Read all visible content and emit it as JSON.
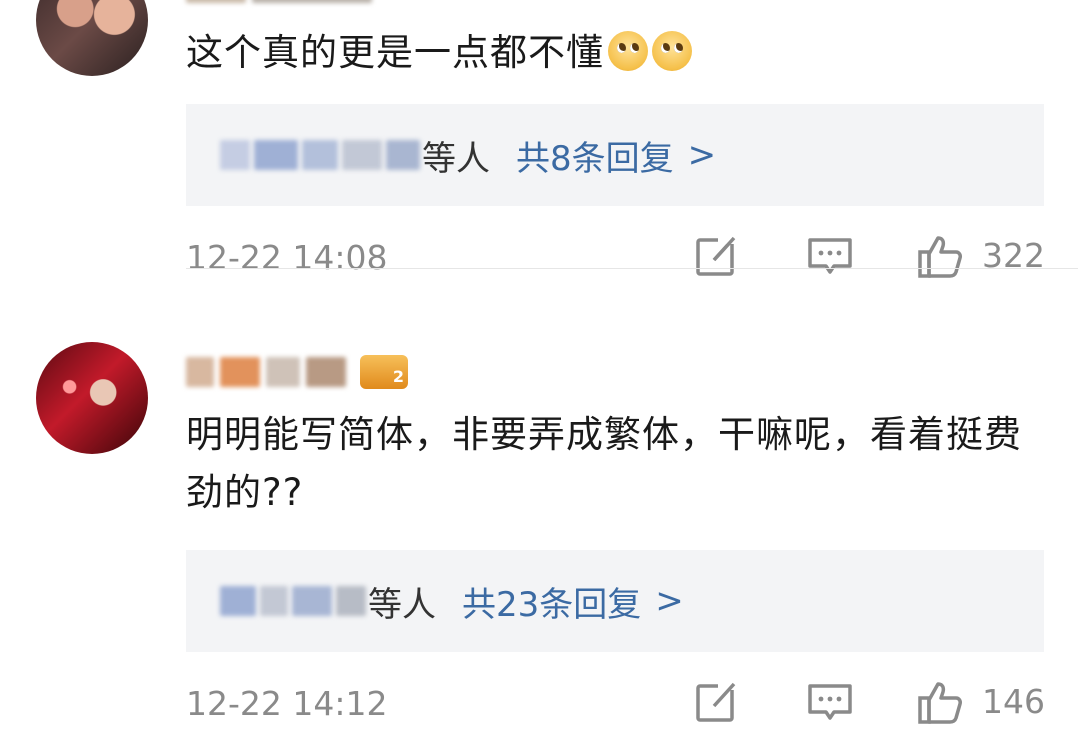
{
  "comments": [
    {
      "text": "这个真的更是一点都不懂",
      "emoji_icons": [
        "pleading-face-emoji",
        "pleading-face-emoji"
      ],
      "reply_suffix": "等人",
      "reply_count": "共8条回复",
      "time": "12-22 14:08",
      "likes": "322"
    },
    {
      "text": "明明能写简体，非要弄成繁体，干嘛呢，看着挺费劲的??",
      "badge_text": "2",
      "reply_suffix": "等人",
      "reply_count": "共23条回复",
      "time": "12-22 14:12",
      "likes": "146"
    }
  ],
  "icons": {
    "reply_arrow": ">",
    "share": "share-icon",
    "comment": "comment-icon",
    "like": "thumbs-up-icon"
  },
  "colors": {
    "link_blue": "#3b6aa3",
    "meta_gray": "#8a8a8a",
    "reply_bg": "#f3f4f6"
  }
}
